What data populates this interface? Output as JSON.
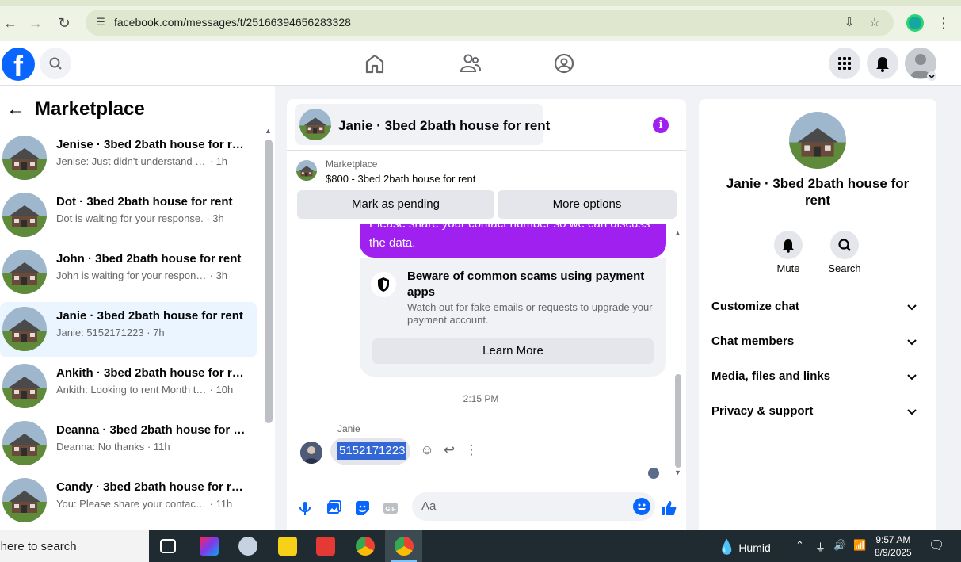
{
  "browser": {
    "url": "facebook.com/messages/t/25166394656283328"
  },
  "left": {
    "title": "Marketplace",
    "conversations": [
      {
        "name": "Jenise · 3bed 2bath house for rent",
        "preview": "Jenise: Just didn't understand the c...",
        "time": "1h",
        "active": false
      },
      {
        "name": "Dot · 3bed 2bath house for rent",
        "preview": "Dot is waiting for your response.",
        "time": "3h",
        "active": false
      },
      {
        "name": "John · 3bed 2bath house for rent",
        "preview": "John is waiting for your response.",
        "time": "3h",
        "active": false
      },
      {
        "name": "Janie · 3bed 2bath house for rent",
        "preview": "Janie: 5152171223",
        "time": "7h",
        "active": true
      },
      {
        "name": "Ankith · 3bed 2bath house for re...",
        "preview": "Ankith: Looking to rent Month to ...",
        "time": "10h",
        "active": false
      },
      {
        "name": "Deanna · 3bed 2bath house for r...",
        "preview": "Deanna: No thanks",
        "time": "11h",
        "active": false
      },
      {
        "name": "Candy · 3bed 2bath house for rent",
        "preview": "You: Please share your contact nu...",
        "time": "11h",
        "active": false
      }
    ]
  },
  "chat": {
    "title": "Janie · 3bed 2bath house for rent",
    "marketplace_label": "Marketplace",
    "listing": "$800 - 3bed 2bath house for rent",
    "mark_pending": "Mark as pending",
    "more_options": "More options",
    "outgoing_line1": "Please share your contact number so we can discuss",
    "outgoing_line2": "the data.",
    "scam_title": "Beware of common scams using payment apps",
    "scam_body": "Watch out for fake emails or requests to upgrade your payment account.",
    "learn_more": "Learn More",
    "timestamp": "2:15 PM",
    "sender": "Janie",
    "incoming": "5152171223",
    "composer_placeholder": "Aa"
  },
  "right": {
    "name": "Janie · 3bed 2bath house for rent",
    "mute": "Mute",
    "search": "Search",
    "rows": [
      "Customize chat",
      "Chat members",
      "Media, files and links",
      "Privacy & support"
    ]
  },
  "taskbar": {
    "search": "Type here to search",
    "weather": "Humid",
    "time": "9:57 AM",
    "date": "8/9/2025"
  },
  "colors": {
    "accent": "#0866ff",
    "bubble": "#a020f0",
    "active_bg": "#ebf5ff"
  }
}
